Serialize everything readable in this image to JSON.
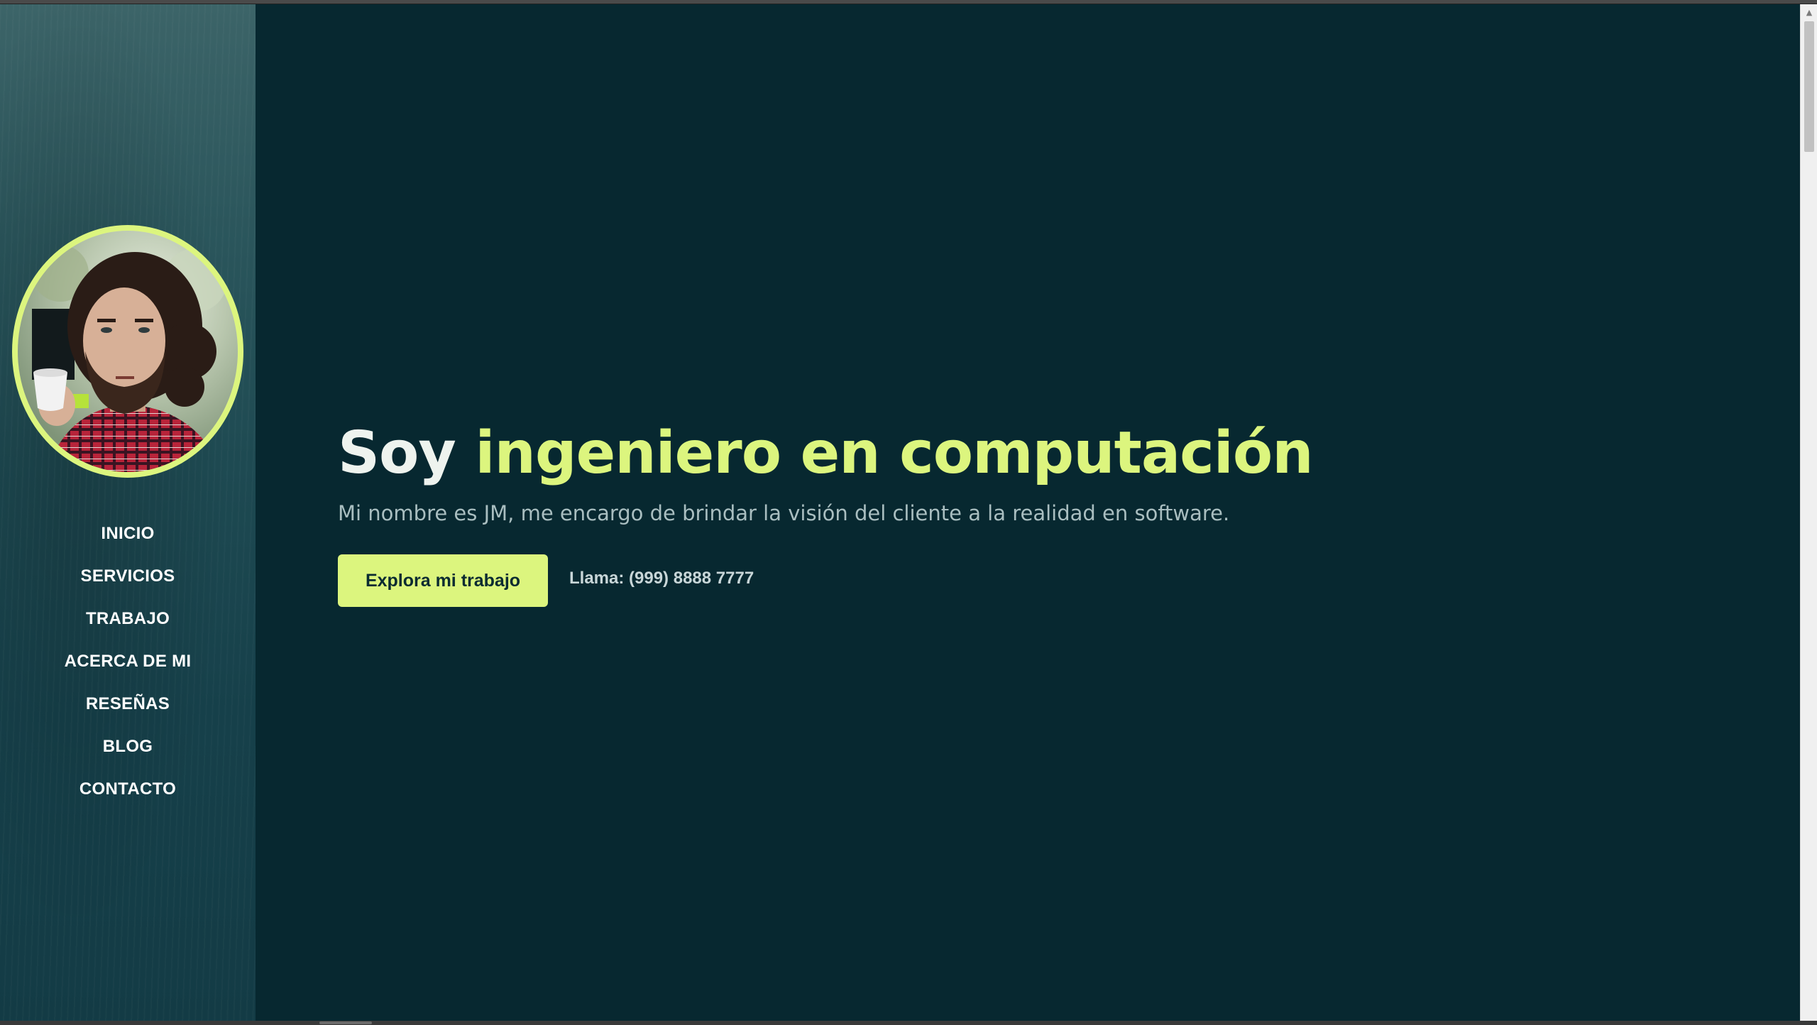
{
  "sidebar": {
    "avatar_alt": "Foto de perfil",
    "nav": [
      {
        "label": "INICIO"
      },
      {
        "label": "SERVICIOS"
      },
      {
        "label": "TRABAJO"
      },
      {
        "label": "ACERCA DE MI"
      },
      {
        "label": "RESEÑAS"
      },
      {
        "label": "BLOG"
      },
      {
        "label": "CONTACTO"
      }
    ]
  },
  "hero": {
    "title_plain": "Soy ",
    "title_accent": "ingeniero en computación",
    "subtitle": "Mi nombre es JM, me encargo de brindar la visión del cliente a la realidad en software.",
    "cta_label": "Explora mi trabajo",
    "phone": "Llama: (999) 8888 7777"
  },
  "colors": {
    "background": "#072830",
    "accent": "#dcf57e",
    "sidebar": "#1e4a52",
    "text_light": "#eef3ee",
    "text_muted": "#a9bec0"
  },
  "icons": {
    "scroll_up": "triangle-up-icon"
  }
}
